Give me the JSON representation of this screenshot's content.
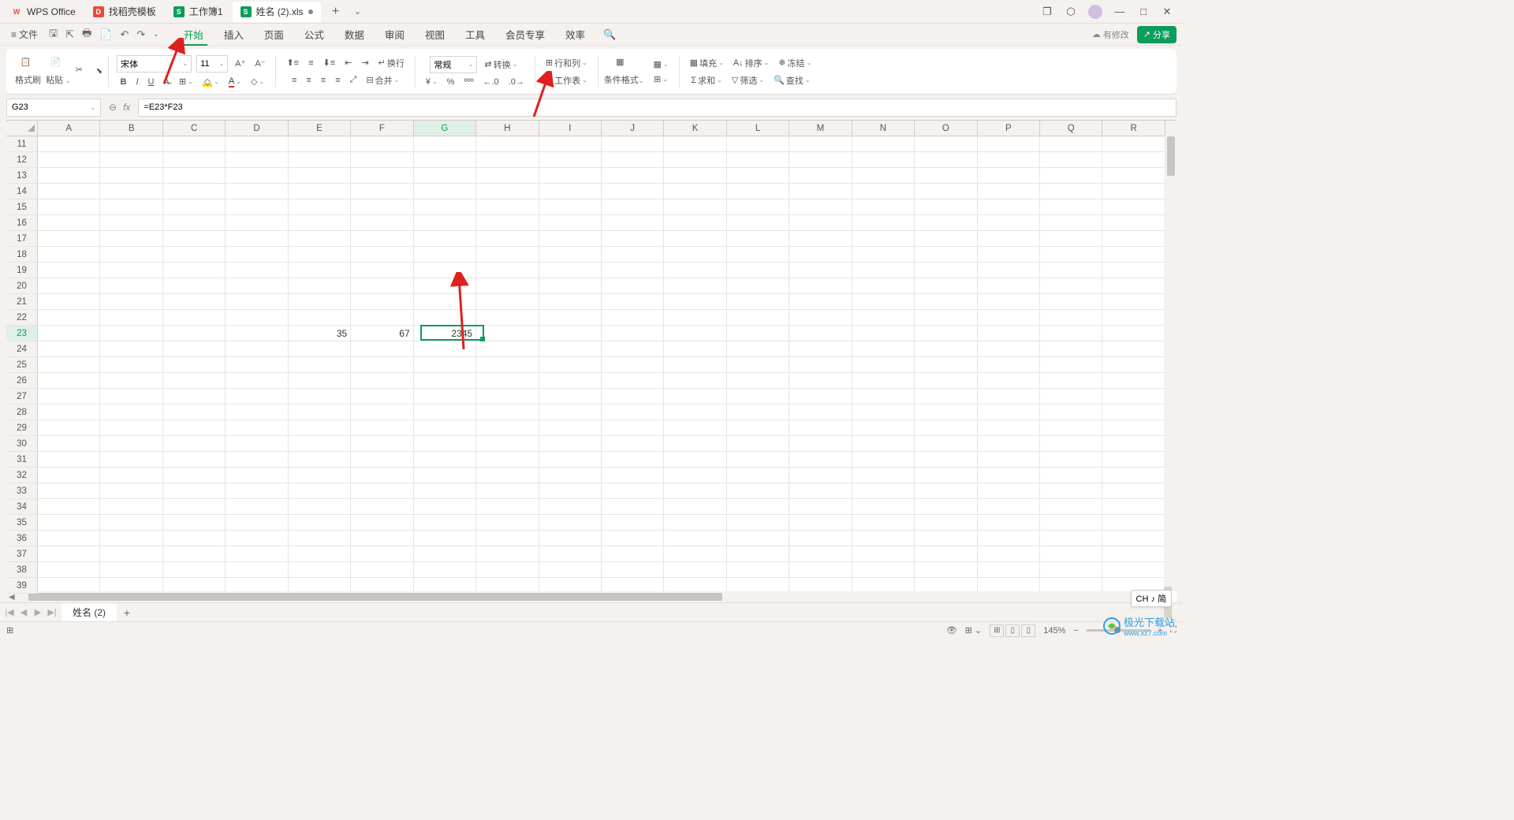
{
  "tabs": [
    {
      "icon": "orange",
      "label": "WPS Office"
    },
    {
      "icon": "red",
      "label": "找稻壳模板"
    },
    {
      "icon": "green",
      "label": "工作簿1"
    },
    {
      "icon": "green",
      "label": "姓名 (2).xls"
    }
  ],
  "file_menu": "文件",
  "menu_tabs": [
    "开始",
    "插入",
    "页面",
    "公式",
    "数据",
    "审阅",
    "视图",
    "工具",
    "会员专享",
    "效率"
  ],
  "modify_text": "有修改",
  "share_text": "分享",
  "ribbon": {
    "format_painter": "格式刷",
    "paste": "粘贴",
    "font_name": "宋体",
    "font_size": "11",
    "wrap": "换行",
    "merge": "合并",
    "number_format": "常规",
    "convert": "转换",
    "row_col": "行和列",
    "worksheet": "工作表",
    "cond_format": "条件格式",
    "fill": "填充",
    "sort": "排序",
    "freeze": "冻结",
    "sum": "求和",
    "filter": "筛选",
    "find": "查找"
  },
  "name_box": "G23",
  "formula": "=E23*F23",
  "columns": [
    "A",
    "B",
    "C",
    "D",
    "E",
    "F",
    "G",
    "H",
    "I",
    "J",
    "K",
    "L",
    "M",
    "N",
    "O",
    "P",
    "Q",
    "R"
  ],
  "row_start": 11,
  "row_end": 39,
  "cell_data": {
    "E23": "35",
    "F23": "67",
    "G23": "2345"
  },
  "selected": {
    "col": "G",
    "row": 23
  },
  "sheet_name": "姓名 (2)",
  "zoom": "145%",
  "ime": "CH ♪ 简",
  "watermark": "极光下载站",
  "watermark_sub": "www.xz7.com"
}
